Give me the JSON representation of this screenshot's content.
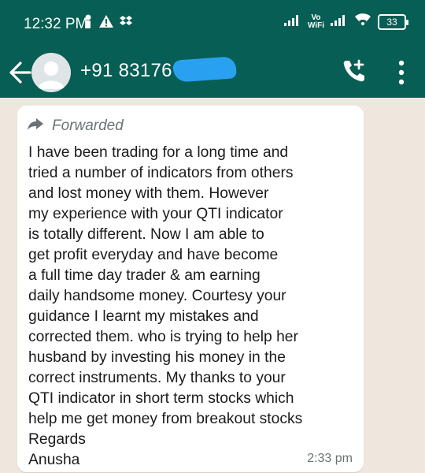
{
  "status_bar": {
    "time": "12:32 PM",
    "network_label": "Vo\nWiFi",
    "battery": "33",
    "icons": [
      "person-icon",
      "alert-icon",
      "dropbox-icon",
      "signal-icon",
      "vowifi-icon",
      "signal-icon",
      "wifi-icon",
      "battery-icon"
    ]
  },
  "header": {
    "contact_name": "+91 83176",
    "icons": [
      "back-arrow-icon",
      "add-call-icon",
      "more-vert-icon"
    ],
    "color": "#075e54"
  },
  "message": {
    "forwarded_label": "Forwarded",
    "text": "I have been trading for a long time and\ntried a number of indicators from others\nand lost money with them. However\nmy experience with your QTI indicator\nis totally different. Now I am able to\nget profit everyday and have become\na full time day trader & am earning\ndaily handsome money. Courtesy your\nguidance I learnt my mistakes and\ncorrected them. who is trying to help her\nhusband by investing his money in the\ncorrect instruments. My thanks to your\nQTI indicator in short term stocks which\nhelp me get money from breakout stocks\nRegards\nAnusha",
    "time": "2:33 pm"
  }
}
